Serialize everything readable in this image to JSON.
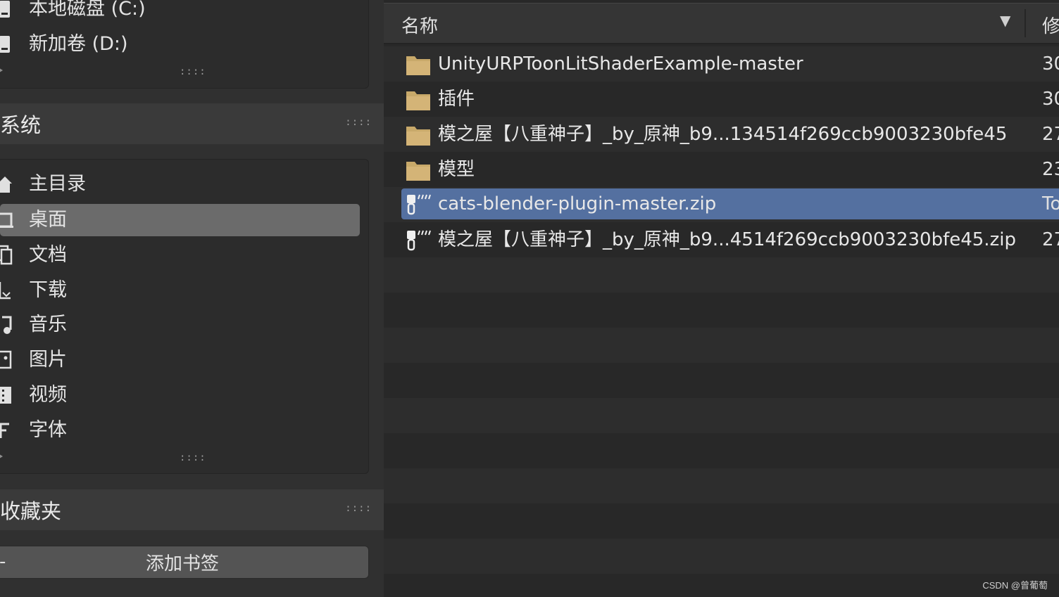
{
  "sidebar": {
    "volumes": [
      {
        "label": "本地磁盘 (C:)",
        "icon": "disk-icon"
      },
      {
        "label": "新加卷 (D:)",
        "icon": "disk-icon"
      }
    ],
    "system_header": "系统",
    "system_items": [
      {
        "label": "主目录",
        "icon": "home-icon"
      },
      {
        "label": "桌面",
        "icon": "desktop-icon",
        "selected": true
      },
      {
        "label": "文档",
        "icon": "documents-icon"
      },
      {
        "label": "下载",
        "icon": "download-icon"
      },
      {
        "label": "音乐",
        "icon": "music-icon"
      },
      {
        "label": "图片",
        "icon": "pictures-icon"
      },
      {
        "label": "视频",
        "icon": "video-icon"
      },
      {
        "label": "字体",
        "icon": "font-icon"
      }
    ],
    "bookmarks_header": "收藏夹",
    "add_bookmark_label": "添加书签",
    "add_bookmark_minus": "-",
    "grip": "::::"
  },
  "filelist": {
    "header_name": "名称",
    "header_sort_arrow": "▼",
    "header_date": "修",
    "files": [
      {
        "name": "UnityURPToonLitShaderExample-master",
        "type": "folder",
        "date": "30"
      },
      {
        "name": "插件",
        "type": "folder",
        "date": "30"
      },
      {
        "name": "模之屋【八重神子】_by_原神_b9...134514f269ccb9003230bfe45",
        "type": "folder",
        "date": "27"
      },
      {
        "name": "模型",
        "type": "folder",
        "date": "23"
      },
      {
        "name": "cats-blender-plugin-master.zip",
        "type": "zip",
        "date": "To",
        "selected": true
      },
      {
        "name": "模之屋【八重神子】_by_原神_b9...4514f269ccb9003230bfe45.zip",
        "type": "zip",
        "date": "27"
      }
    ]
  },
  "watermark": "CSDN @曾葡萄",
  "colors": {
    "selection": "#5470a0",
    "folder": "#c8a96a",
    "sidebar_selected": "#6b6b6b"
  }
}
